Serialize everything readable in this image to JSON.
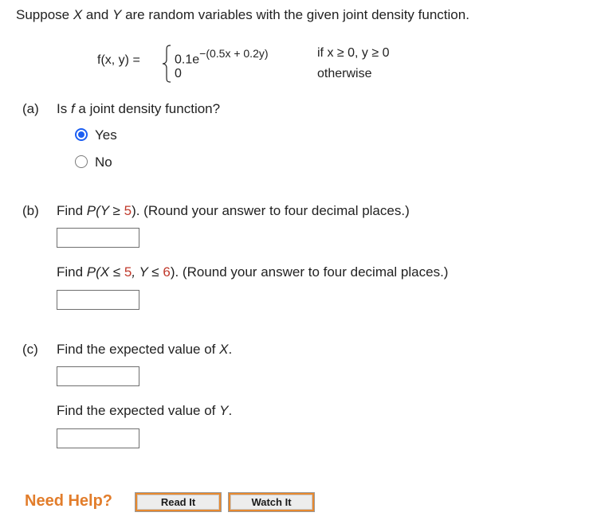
{
  "intro": {
    "pre": "Suppose ",
    "x": "X",
    "mid": " and ",
    "y": "Y",
    "post": " are random variables with the given joint density function."
  },
  "function": {
    "lhs": "f(x, y) =",
    "case1_base": "0.1e",
    "case1_exp": "−(0.5x + 0.2y)",
    "case1_cond": "if x ≥ 0, y ≥ 0",
    "case2_value": "0",
    "case2_cond": "otherwise"
  },
  "part_a": {
    "label": "(a)",
    "question_pre": "Is ",
    "question_f": "f",
    "question_post": " a joint density function?",
    "options": [
      {
        "label": "Yes",
        "selected": true
      },
      {
        "label": "No",
        "selected": false
      }
    ]
  },
  "part_b": {
    "label": "(b)",
    "q1_pre": "Find ",
    "q1_prob": "P(Y ≥ ",
    "q1_val": "5",
    "q1_post": "). (Round your answer to four decimal places.)",
    "q2_pre": "Find ",
    "q2_prob1": "P(X ≤ ",
    "q2_val1": "5",
    "q2_mid": ", Y ≤ ",
    "q2_val2": "6",
    "q2_post": "). (Round your answer to four decimal places.)"
  },
  "part_c": {
    "label": "(c)",
    "q1_pre": "Find the expected value of ",
    "q1_var": "X",
    "q1_post": ".",
    "q2_pre": "Find the expected value of ",
    "q2_var": "Y",
    "q2_post": "."
  },
  "help": {
    "title": "Need Help?",
    "read_it": "Read It",
    "watch_it": "Watch It"
  },
  "colors": {
    "accent_radio": "#1d5ff2",
    "highlight_number": "#c0392b",
    "need_help": "#e27d2b"
  }
}
